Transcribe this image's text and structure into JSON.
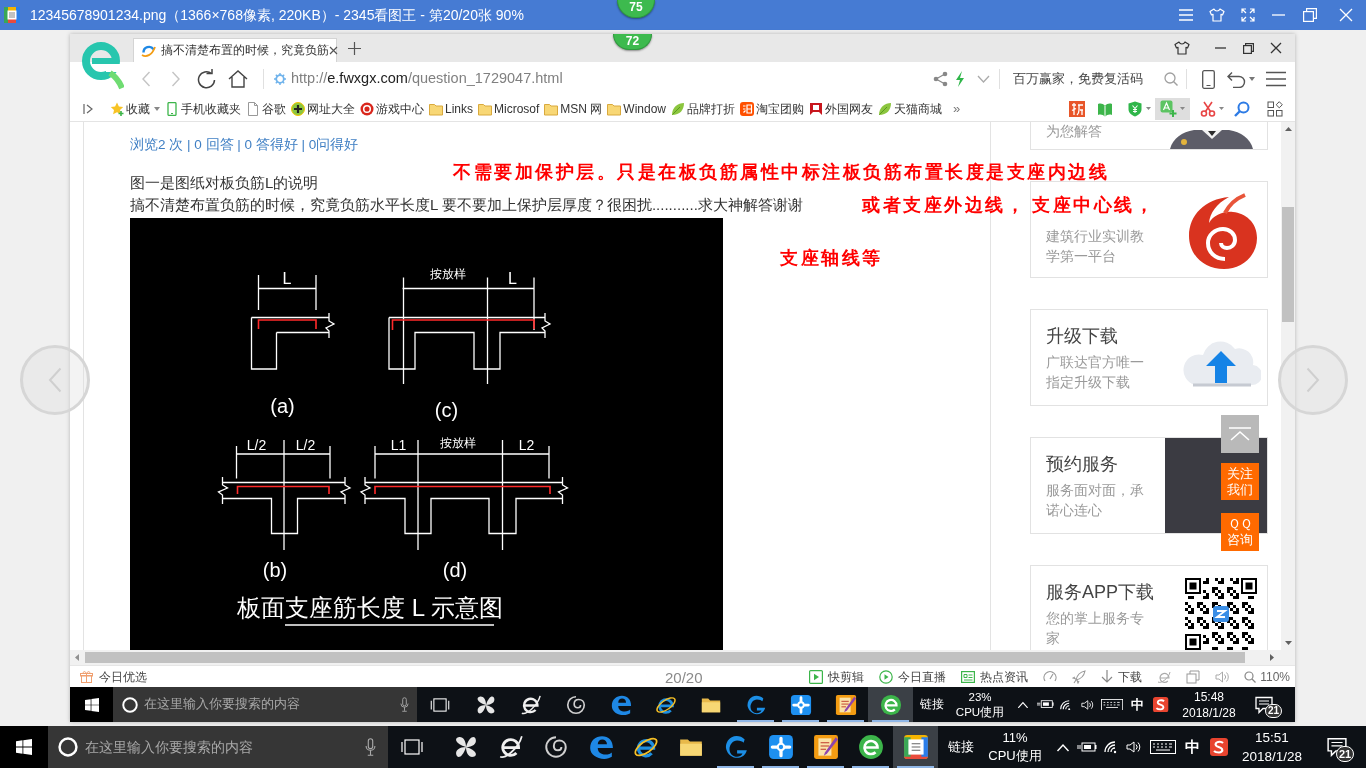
{
  "viewer": {
    "title": "12345678901234.png（1366×768像素, 220KB）- 2345看图王 - 第20/20张 90%",
    "counter": "20/20"
  },
  "badges": [
    "75",
    "72"
  ],
  "browser": {
    "tab": {
      "title": "搞不清楚布置的时候，究竟负筋"
    },
    "url": {
      "scheme": "http://",
      "host": "e.fwxgx.com",
      "path": "/question_1729047.html"
    },
    "search": {
      "placeholder": "百万赢家，免费复活码"
    },
    "bookmarks": [
      {
        "kind": "favorites",
        "label": "收藏"
      },
      {
        "kind": "mobile",
        "label": "手机收藏夹"
      },
      {
        "kind": "page",
        "label": "谷歌"
      },
      {
        "kind": "site",
        "label": "网址大全"
      },
      {
        "kind": "game",
        "label": "游戏中心"
      },
      {
        "kind": "folder",
        "label": "Links"
      },
      {
        "kind": "folder",
        "label": "Microsof"
      },
      {
        "kind": "folder",
        "label": "MSN 网"
      },
      {
        "kind": "folder",
        "label": "Window"
      },
      {
        "kind": "leaf",
        "label": "品牌打折"
      },
      {
        "kind": "taobao",
        "label": "淘宝团购"
      },
      {
        "kind": "flag",
        "label": "外国网友"
      },
      {
        "kind": "leaf",
        "label": "天猫商城"
      }
    ],
    "more": "»"
  },
  "page": {
    "stats": "浏览2 次 | 0 回答 | 0 答得好 | 0问得好",
    "question": [
      "图一是图纸对板负筋L的说明",
      "搞不清楚布置负筋的时候，究竟负筋水平长度L 要不要加上保护层厚度？很困扰...........求大神解答谢谢"
    ],
    "figure": {
      "panels": [
        {
          "kind": "end",
          "labels": [
            "L"
          ],
          "caption": "(a)"
        },
        {
          "kind": "end-extended",
          "labels": [
            "按放样",
            "L"
          ],
          "caption": "(c)"
        },
        {
          "kind": "middle",
          "labels": [
            "L/2",
            "L/2"
          ],
          "caption": "(b)"
        },
        {
          "kind": "middle-extended",
          "labels": [
            "L1",
            "按放样",
            "L2"
          ],
          "caption": "(d)"
        }
      ],
      "title": "板面支座筋长度 L 示意图"
    },
    "annotations": [
      "不需要加保护层。只是在板负筋属性中标注板负筋布置长度是支座内边线",
      "或者支座外边线，",
      "支座轴线等"
    ]
  },
  "sidebar": {
    "cards": [
      {
        "kind": "agent",
        "subtitle": "为您解答"
      },
      {
        "kind": "logo",
        "subtitle": "建筑行业实训教学第一平台",
        "annotation": "支座中心线，"
      },
      {
        "kind": "cloud",
        "title": "升级下载",
        "subtitle": "广联达官方唯一指定升级下载"
      },
      {
        "kind": "handshake",
        "title": "预约服务",
        "subtitle": "服务面对面，承诺心连心"
      },
      {
        "kind": "qr",
        "title": "服务APP下载",
        "subtitle": "您的掌上服务专家"
      }
    ],
    "float_buttons": [
      {
        "kind": "top"
      },
      {
        "kind": "follow",
        "label": "关注我们"
      },
      {
        "kind": "consult",
        "label": "ＱＱ咨询"
      }
    ]
  },
  "status_bar": {
    "left": "今日优选",
    "items": [
      {
        "kind": "clip",
        "label": "快剪辑"
      },
      {
        "kind": "live",
        "label": "今日直播"
      },
      {
        "kind": "news",
        "label": "热点资讯"
      },
      {
        "kind": "speed"
      },
      {
        "kind": "rocket"
      },
      {
        "kind": "download",
        "label": "下载"
      },
      {
        "kind": "ie"
      },
      {
        "kind": "window"
      },
      {
        "kind": "sound"
      }
    ],
    "zoom": "110%"
  },
  "taskbars": [
    {
      "search": {
        "placeholder": "在这里输入你要搜索的内容"
      },
      "apps": [
        {
          "kind": "pinwheel",
          "selected": false,
          "running": false
        },
        {
          "kind": "ie-e",
          "selected": false,
          "running": false
        },
        {
          "kind": "swirl",
          "selected": false,
          "running": false
        },
        {
          "kind": "edge",
          "selected": false,
          "running": false
        },
        {
          "kind": "ie",
          "selected": false,
          "running": false
        },
        {
          "kind": "folder",
          "selected": false,
          "running": false
        },
        {
          "kind": "glodon",
          "selected": false,
          "running": true
        },
        {
          "kind": "plus",
          "selected": false,
          "running": true
        },
        {
          "kind": "notes",
          "selected": false,
          "running": true
        },
        {
          "kind": "browser",
          "selected": true,
          "running": true
        }
      ],
      "link": "链接",
      "cpu_value": "23%",
      "cpu_label": "CPU使用",
      "ime": "中",
      "time": "15:48",
      "date": "2018/1/28",
      "notifications": "21"
    },
    {
      "search": {
        "placeholder": "在这里输入你要搜索的内容"
      },
      "apps": [
        {
          "kind": "pinwheel",
          "selected": false,
          "running": false
        },
        {
          "kind": "ie-e",
          "selected": false,
          "running": false
        },
        {
          "kind": "swirl",
          "selected": false,
          "running": false
        },
        {
          "kind": "edge",
          "selected": false,
          "running": false
        },
        {
          "kind": "ie",
          "selected": false,
          "running": false
        },
        {
          "kind": "folder",
          "selected": false,
          "running": false
        },
        {
          "kind": "glodon",
          "selected": false,
          "running": true
        },
        {
          "kind": "plus",
          "selected": false,
          "running": true
        },
        {
          "kind": "notes",
          "selected": false,
          "running": true
        },
        {
          "kind": "browser",
          "selected": false,
          "running": true
        },
        {
          "kind": "viewer",
          "selected": true,
          "running": true
        }
      ],
      "link": "链接",
      "cpu_value": "11%",
      "cpu_label": "CPU使用",
      "ime": "中",
      "time": "15:51",
      "date": "2018/1/28",
      "notifications": "21"
    }
  ]
}
